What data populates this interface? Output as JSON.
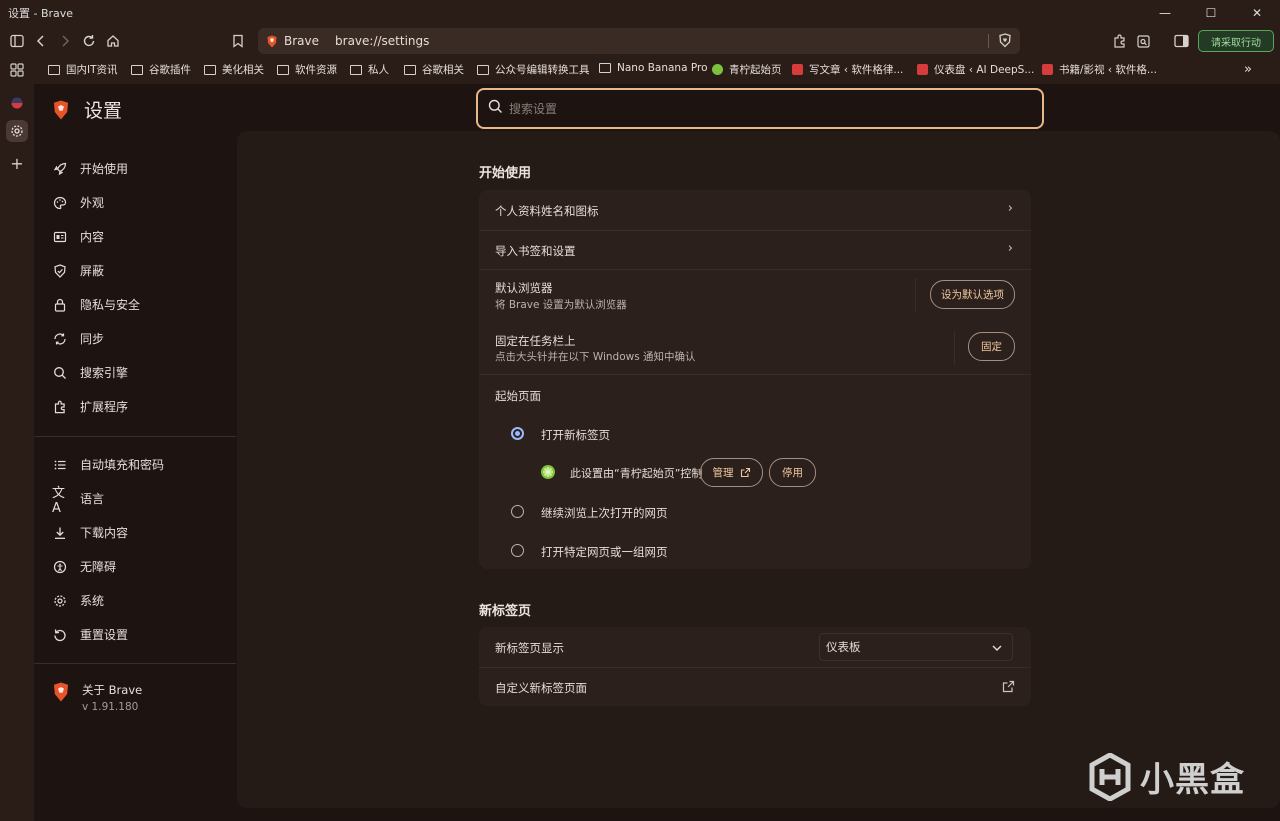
{
  "window": {
    "title": "设置 - Brave"
  },
  "toolbar": {
    "site_name": "Brave",
    "url": "brave://settings",
    "rewards_label": "请采取行动"
  },
  "bookmarks": [
    {
      "label": "国内IT资讯",
      "type": "folder"
    },
    {
      "label": "谷歌插件",
      "type": "folder"
    },
    {
      "label": "美化相关",
      "type": "folder"
    },
    {
      "label": "软件资源",
      "type": "folder"
    },
    {
      "label": "私人",
      "type": "folder"
    },
    {
      "label": "谷歌相关",
      "type": "folder"
    },
    {
      "label": "公众号编辑转换工具",
      "type": "folder"
    },
    {
      "label": "Nano Banana Pro",
      "type": "folder"
    },
    {
      "label": "青柠起始页",
      "type": "site"
    },
    {
      "label": "写文章 ‹ 软件格律...",
      "type": "site"
    },
    {
      "label": "仪表盘 ‹ AI DeepS...",
      "type": "site"
    },
    {
      "label": "书籍/影视 ‹ 软件格...",
      "type": "site"
    }
  ],
  "settings": {
    "title": "设置",
    "search_placeholder": "搜索设置",
    "nav_group1": [
      "开始使用",
      "外观",
      "内容",
      "屏蔽",
      "隐私与安全",
      "同步",
      "搜索引擎",
      "扩展程序"
    ],
    "nav_group2": [
      "自动填充和密码",
      "语言",
      "下载内容",
      "无障碍",
      "系统",
      "重置设置"
    ],
    "about_label": "关于 Brave",
    "version": "v 1.91.180"
  },
  "section_start": {
    "title": "开始使用",
    "profile_row": "个人资料姓名和图标",
    "import_row": "导入书签和设置",
    "default_browser_label": "默认浏览器",
    "default_browser_sub": "将 Brave 设置为默认浏览器",
    "default_browser_btn": "设为默认选项",
    "pin_label": "固定在任务栏上",
    "pin_sub": "点击大头针并在以下 Windows 通知中确认",
    "pin_btn": "固定",
    "startup_label": "起始页面",
    "opt_newtab": "打开新标签页",
    "controlled_text": "此设置由“青柠起始页”控制",
    "manage_btn": "管理",
    "disable_btn": "停用",
    "opt_continue": "继续浏览上次打开的网页",
    "opt_specific": "打开特定网页或一组网页"
  },
  "section_newtab": {
    "title": "新标签页",
    "show_label": "新标签页显示",
    "show_value": "仪表板",
    "customize_label": "自定义新标签页面"
  },
  "watermark": {
    "text": "小黑盒"
  }
}
